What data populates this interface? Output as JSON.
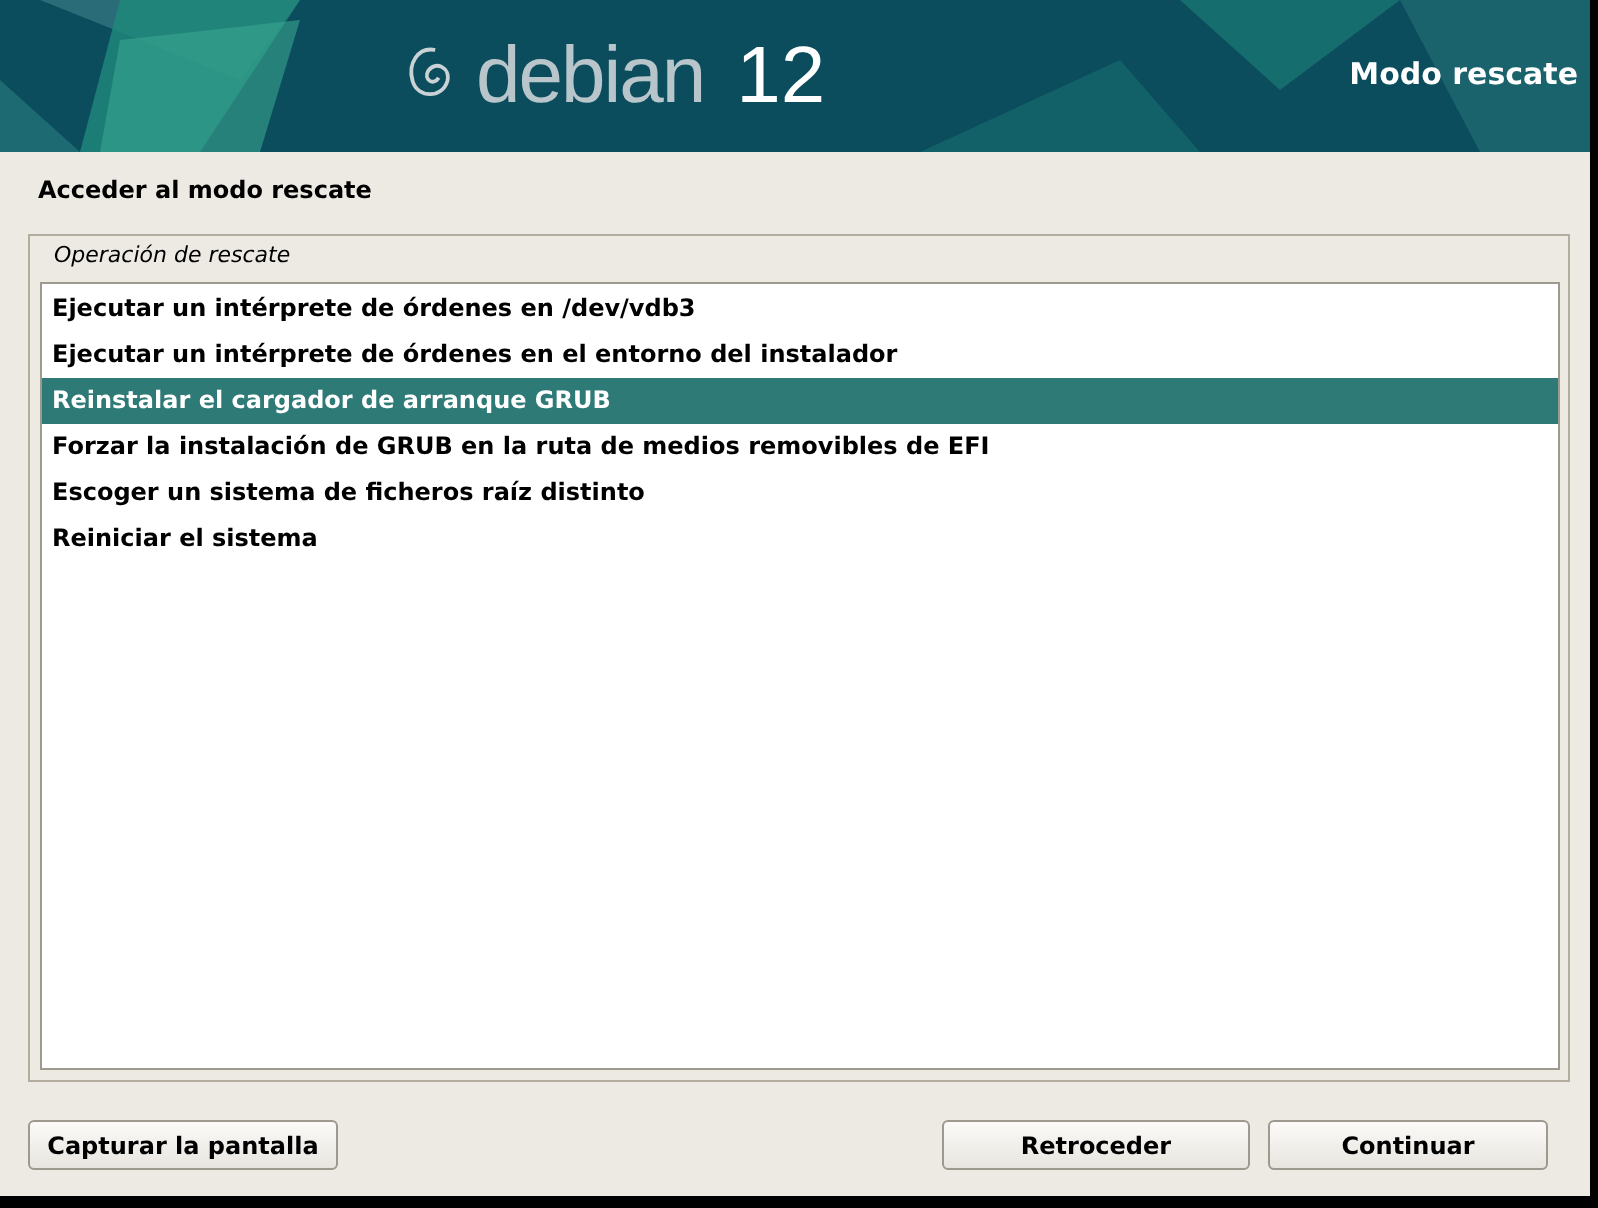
{
  "banner": {
    "logo_word": "debian",
    "logo_version": "12",
    "mode_title": "Modo rescate"
  },
  "heading": "Acceder al modo rescate",
  "group": {
    "legend": "Operación de rescate",
    "items": [
      {
        "label": "Ejecutar un intérprete de órdenes en /dev/vdb3",
        "selected": false
      },
      {
        "label": "Ejecutar un intérprete de órdenes en el entorno del instalador",
        "selected": false
      },
      {
        "label": "Reinstalar el cargador de arranque GRUB",
        "selected": true
      },
      {
        "label": "Forzar la instalación de GRUB en la ruta de medios removibles de EFI",
        "selected": false
      },
      {
        "label": "Escoger un sistema de ficheros raíz distinto",
        "selected": false
      },
      {
        "label": "Reiniciar el sistema",
        "selected": false
      }
    ]
  },
  "buttons": {
    "left": [
      "Capturar la pantalla"
    ],
    "right": [
      "Retroceder",
      "Continuar"
    ]
  }
}
